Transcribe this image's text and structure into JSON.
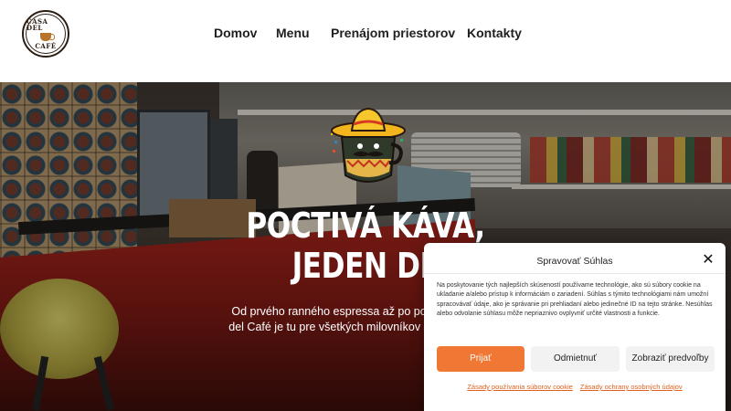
{
  "header": {
    "logo": {
      "text_top": "CASA DEL",
      "text_bottom": "CAFÉ"
    },
    "nav": [
      {
        "label": "Domov"
      },
      {
        "label": "Menu"
      },
      {
        "label": "Prenájom priestorov"
      },
      {
        "label": "Kontakty"
      }
    ]
  },
  "hero": {
    "headline_line1": "POCTIVÁ KÁVA,",
    "headline_line2": "JEDEN DE",
    "subtext_line1": "Od prvého ranného espressa až po popoludňajšie ca",
    "subtext_line2": "del Café je tu pre všetkých milovníkov skutočnej chuti."
  },
  "consent": {
    "title": "Spravovať Súhlas",
    "body": "Na poskytovanie tých najlepších skúseností používame technológie, ako sú súbory cookie na ukladanie a/alebo prístup k informáciám o zariadení. Súhlas s týmito technológiami nám umožní spracovávať údaje, ako je správanie pri prehliadaní alebo jedinečné ID na tejto stránke. Nesúhlas alebo odvolanie súhlasu môže nepriaznivo ovplyvniť určité vlastnosti a funkcie.",
    "accept_label": "Prijať",
    "deny_label": "Odmietnuť",
    "prefs_label": "Zobraziť predvoľby",
    "link_cookies": "Zásady používania súborov cookie",
    "link_privacy": "Zásady ochrany osobných údajov",
    "close_icon": "close-icon",
    "accent_color": "#f07834"
  }
}
